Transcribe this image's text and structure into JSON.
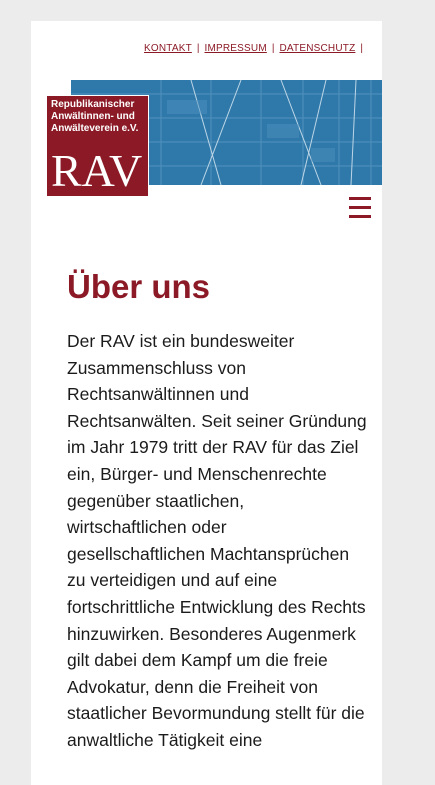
{
  "topnav": {
    "items": [
      "KONTAKT",
      "IMPRESSUM",
      "DATENSCHUTZ"
    ],
    "separator": "|"
  },
  "logo": {
    "subtitle": "Republikanischer\nAnwältinnen- und\nAnwälteverein e.V.",
    "mark": "RAV"
  },
  "menu": {
    "icon": "hamburger-icon"
  },
  "main": {
    "title": "Über uns",
    "paragraph": "Der RAV ist ein bundesweiter Zusammenschluss von Rechtsanwältinnen und Rechtsanwälten. Seit seiner Gründung im Jahr 1979 tritt der RAV für das Ziel ein, Bürger- und Menschenrechte gegenüber staatlichen, wirtschaftlichen oder gesellschaftlichen Machtansprüchen zu verteidigen und auf eine fortschrittliche Entwicklung des Rechts hinzuwirken. Besonderes Augenmerk gilt dabei dem Kampf um die freie Advokatur, denn die Freiheit von staatlicher Bevormundung stellt für die anwaltliche Tätigkeit eine"
  },
  "colors": {
    "brand": "#8b1a26",
    "banner": "#2e78a8",
    "background": "#ececec",
    "text": "#1b1b1b"
  }
}
